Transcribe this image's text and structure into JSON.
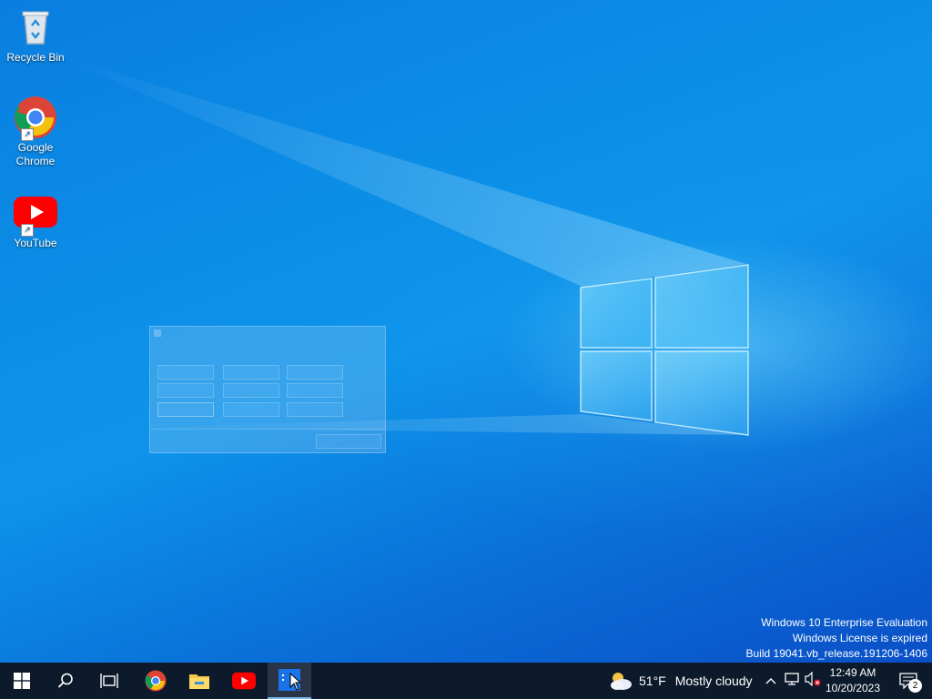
{
  "desktop": {
    "icons": [
      {
        "label": "Recycle Bin",
        "icon": "recycle-bin-icon"
      },
      {
        "label": "Google\nChrome",
        "icon": "chrome-icon"
      },
      {
        "label": "YouTube",
        "icon": "youtube-icon"
      }
    ]
  },
  "watermark": {
    "line1": "Windows 10 Enterprise Evaluation",
    "line2": "Windows License is expired",
    "line3": "Build 19041.vb_release.191206-1406"
  },
  "taskbar": {
    "start_icon": "windows-start-icon",
    "search_icon": "search-icon",
    "taskview_icon": "task-view-icon",
    "pinned": [
      {
        "name": "chrome",
        "icon": "chrome-icon"
      },
      {
        "name": "file-explorer",
        "icon": "folder-icon"
      },
      {
        "name": "youtube",
        "icon": "youtube-icon"
      },
      {
        "name": "active-app",
        "icon": "app-icon",
        "active": true
      }
    ],
    "weather": {
      "temp": "51°F",
      "condition": "Mostly cloudy",
      "icon": "partly-cloudy-icon"
    },
    "tray_icons": [
      "chevron-up-icon",
      "network-icon",
      "volume-muted-icon"
    ],
    "clock": {
      "time": "12:49 AM",
      "date": "10/20/2023"
    },
    "notifications": {
      "count": "2",
      "icon": "action-center-icon"
    }
  },
  "colors": {
    "taskbar_bg": "#0c1a2b",
    "desktop_blue": "#0b8de6",
    "active_indicator": "#76b9ed"
  }
}
